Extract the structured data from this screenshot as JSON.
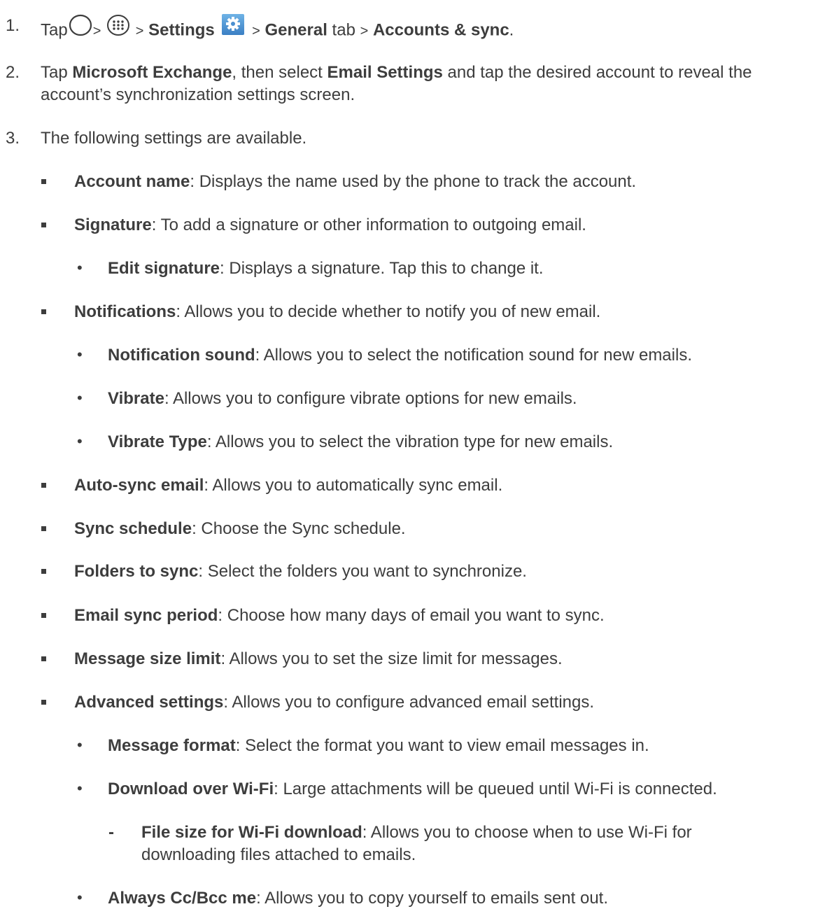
{
  "steps": [
    {
      "number": "1.",
      "text_tap": "Tap",
      "sep": ">",
      "settings_label": "Settings",
      "general_label": "General",
      "tab_word": "tab",
      "accounts_label": "Accounts & sync",
      "period": ".",
      "icons": [
        "home-circle-icon",
        "apps-icon",
        "settings-gear-icon"
      ]
    },
    {
      "number": "2.",
      "text_a": "Tap ",
      "bold_a": "Microsoft Exchange",
      "text_b": ", then select ",
      "bold_b": "Email Settings",
      "text_c": " and tap the desired account to reveal the",
      "text_line2": "account’s synchronization settings screen."
    },
    {
      "number": "3.",
      "text": "The following settings are available."
    }
  ],
  "items": [
    {
      "bold": "Account name",
      "text": ": Displays the name used by the phone to track the account."
    },
    {
      "bold": "Signature",
      "text": ": To add a signature or other information to outgoing email."
    },
    {
      "bold": "Edit signature",
      "text": ": Displays a signature. Tap this to change it."
    },
    {
      "bold": "Notifications",
      "text": ": Allows you to decide whether to notify you of new email."
    },
    {
      "bold": "Notification sound",
      "text": ": Allows you to select the notification sound for new emails."
    },
    {
      "bold": "Vibrate",
      "text": ": Allows you to configure vibrate options for new emails."
    },
    {
      "bold": "Vibrate Type",
      "text": ": Allows you to select the vibration type for new emails."
    },
    {
      "bold": "Auto-sync email",
      "text": ": Allows you to automatically sync email."
    },
    {
      "bold": "Sync schedule",
      "text": ": Choose the Sync schedule."
    },
    {
      "bold": "Folders to sync",
      "text": ": Select the folders you want to synchronize."
    },
    {
      "bold": "Email sync period",
      "text": ": Choose how many days of email you want to sync."
    },
    {
      "bold": "Message size limit",
      "text": ": Allows you to set the size limit for messages."
    },
    {
      "bold": "Advanced settings",
      "text": ": Allows you to configure advanced email settings."
    },
    {
      "bold": "Message format",
      "text": ": Select the format you want to view email messages in."
    },
    {
      "bold": "Download over Wi-Fi",
      "text": ": Large attachments will be queued until Wi-Fi is connected."
    },
    {
      "bold": "File size for Wi-Fi download",
      "text": ": Allows you to choose when to use Wi-Fi for",
      "text_line2": "downloading files attached to emails."
    },
    {
      "bold": "Always Cc/Bcc me",
      "text": ": Allows you to copy yourself to emails sent out."
    }
  ],
  "markers": {
    "dash": "-",
    "bullet": "•"
  },
  "colors": {
    "text": "#3d3d3d",
    "settings_icon_bg": "#4a8fd0"
  }
}
